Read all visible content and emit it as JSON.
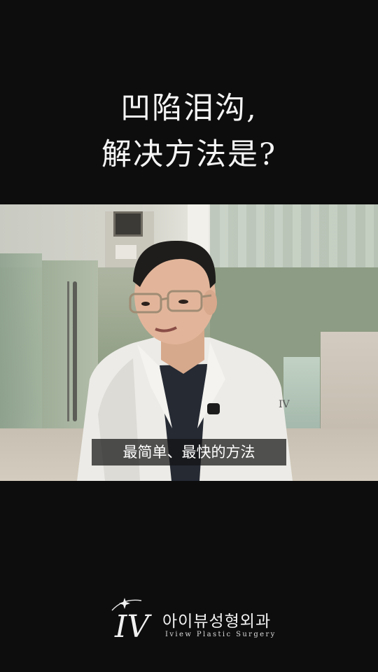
{
  "headline": {
    "line1": "凹陷泪沟,",
    "line2": "解决方法是?"
  },
  "video": {
    "subtitle": "最简单、最快的方法"
  },
  "brand": {
    "name_korean": "아이뷰성형외과",
    "name_english": "Iview Plastic Surgery",
    "monogram": "IV"
  },
  "colors": {
    "background": "#0d0d0d",
    "text": "#f4f4f4",
    "caption_bg": "#141414"
  }
}
